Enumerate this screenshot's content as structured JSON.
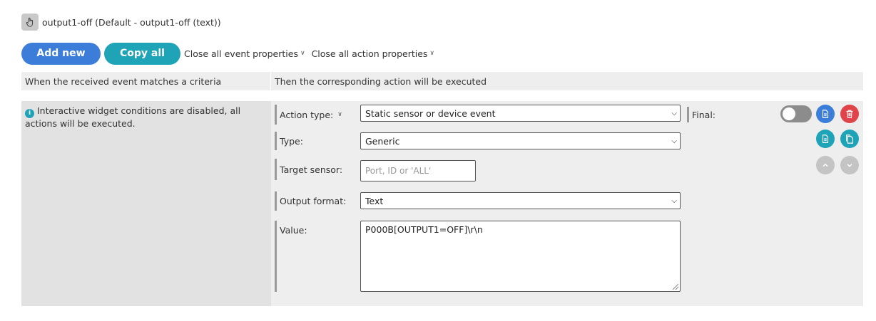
{
  "widget": {
    "icon": "hand-pointer-icon",
    "title": "output1-off (Default - output1-off (text))"
  },
  "toolbar": {
    "add_new": "Add new",
    "copy_all": "Copy all",
    "close_events": "Close all event properties",
    "close_actions": "Close all action properties"
  },
  "columns": {
    "left": "When the received event matches a criteria",
    "right": "Then the corresponding action will be executed"
  },
  "rule": {
    "info": "Interactive widget conditions are disabled, all actions will be executed.",
    "action_type": {
      "label": "Action type:",
      "value": "Static sensor or device event"
    },
    "type": {
      "label": "Type:",
      "value": "Generic"
    },
    "target_sensor": {
      "label": "Target sensor:",
      "placeholder": "Port, ID or 'ALL'"
    },
    "output_format": {
      "label": "Output format:",
      "value": "Text"
    },
    "value": {
      "label": "Value:",
      "text": "P000B[OUTPUT1=OFF]\\r\\n"
    },
    "final": {
      "label": "Final:",
      "enabled": false
    }
  },
  "colors": {
    "primary_blue": "#3b7dd8",
    "teal": "#1fa3b7",
    "danger_red": "#e0444b",
    "panel_grey": "#eeeeee"
  }
}
